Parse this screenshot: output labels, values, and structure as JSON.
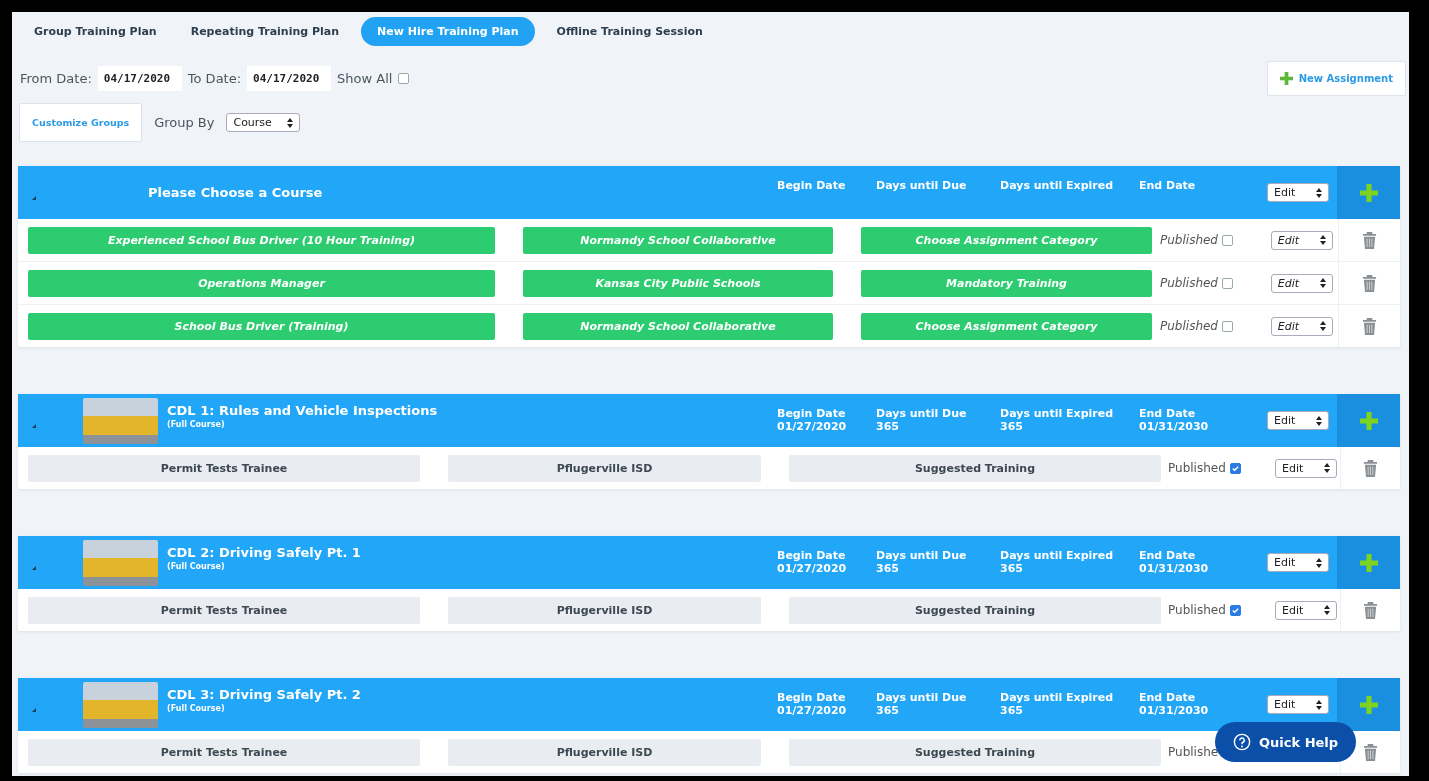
{
  "tabs": [
    {
      "label": "Group Training Plan",
      "selected": false
    },
    {
      "label": "Repeating Training Plan",
      "selected": false
    },
    {
      "label": "New Hire Training Plan",
      "selected": true
    },
    {
      "label": "Offline Training Session",
      "selected": false
    }
  ],
  "filters": {
    "from_label": "From Date:",
    "from_value": "04/17/2020",
    "to_label": "To Date:",
    "to_value": "04/17/2020",
    "show_all_label": "Show All",
    "show_all": false
  },
  "new_assignment": "New Assignment",
  "customize_groups": "Customize Groups",
  "group_by": {
    "label": "Group By",
    "value": "Course"
  },
  "groups": [
    {
      "title": "Please Choose a Course",
      "has_photo": false,
      "begin_label": "Begin Date",
      "due_label": "Days until Due",
      "expired_label": "Days until Expired",
      "end_label": "End Date",
      "edit": "Edit",
      "rows": [
        {
          "kind": "assigned",
          "cells": [
            "Experienced School Bus Driver (10 Hour Training)",
            "Normandy School Collaborative",
            "Choose Assignment Category"
          ],
          "published_label": "Published",
          "published": false,
          "edit": "Edit"
        },
        {
          "kind": "assigned",
          "cells": [
            "Operations Manager",
            "Kansas City Public Schools",
            "Mandatory Training"
          ],
          "published_label": "Published",
          "published": false,
          "edit": "Edit"
        },
        {
          "kind": "assigned",
          "cells": [
            "School Bus Driver (Training)",
            "Normandy School Collaborative",
            "Choose Assignment Category"
          ],
          "published_label": "Published",
          "published": false,
          "edit": "Edit"
        }
      ]
    },
    {
      "title": "CDL 1: Rules and Vehicle Inspections",
      "subtitle": "(Full Course)",
      "has_photo": true,
      "begin_label": "Begin Date",
      "begin_value": "01/27/2020",
      "due_label": "Days until Due",
      "due_value": "365",
      "expired_label": "Days until Expired",
      "expired_value": "365",
      "end_label": "End Date",
      "end_value": "01/31/2030",
      "edit": "Edit",
      "rows": [
        {
          "kind": "default",
          "cells": [
            "Permit Tests Trainee",
            "Pflugerville ISD",
            "Suggested Training"
          ],
          "published_label": "Published",
          "published": true,
          "edit": "Edit"
        }
      ]
    },
    {
      "title": "CDL 2: Driving Safely Pt. 1",
      "subtitle": "(Full Course)",
      "has_photo": true,
      "begin_label": "Begin Date",
      "begin_value": "01/27/2020",
      "due_label": "Days until Due",
      "due_value": "365",
      "expired_label": "Days until Expired",
      "expired_value": "365",
      "end_label": "End Date",
      "end_value": "01/31/2030",
      "edit": "Edit",
      "rows": [
        {
          "kind": "default",
          "cells": [
            "Permit Tests Trainee",
            "Pflugerville ISD",
            "Suggested Training"
          ],
          "published_label": "Published",
          "published": true,
          "edit": "Edit"
        }
      ]
    },
    {
      "title": "CDL 3: Driving Safely Pt. 2",
      "subtitle": "(Full Course)",
      "has_photo": true,
      "begin_label": "Begin Date",
      "begin_value": "01/27/2020",
      "due_label": "Days until Due",
      "due_value": "365",
      "expired_label": "Days until Expired",
      "expired_value": "365",
      "end_label": "End Date",
      "end_value": "01/31/2030",
      "edit": "Edit",
      "rows": [
        {
          "kind": "default",
          "cells": [
            "Permit Tests Trainee",
            "Pflugerville ISD",
            "Suggested Training"
          ],
          "published_label": "Publishe"
        }
      ]
    }
  ],
  "quick_help": "Quick Help"
}
